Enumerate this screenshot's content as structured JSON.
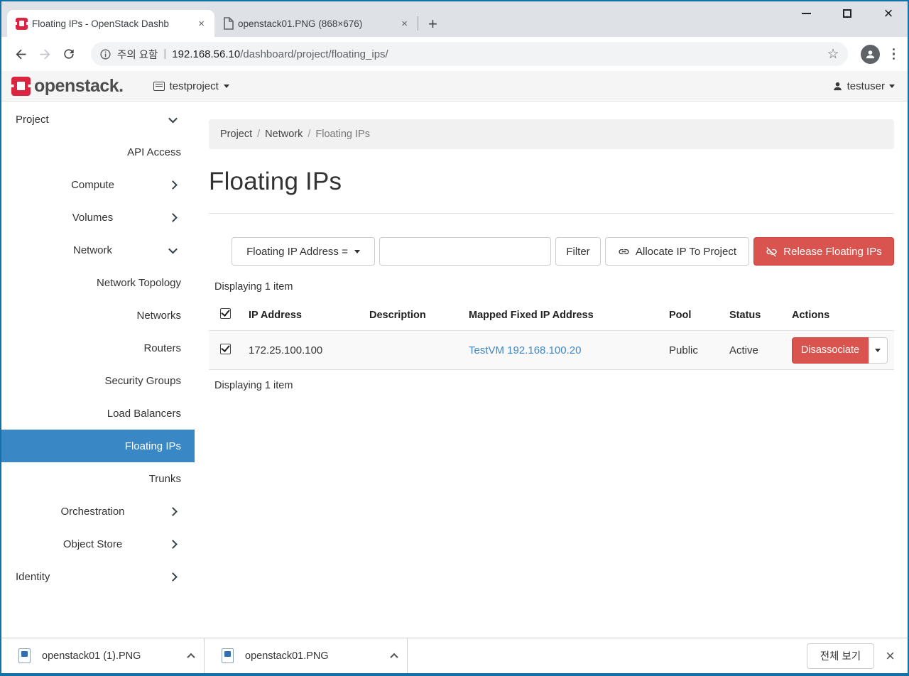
{
  "browser": {
    "tabs": [
      {
        "title": "Floating IPs - OpenStack Dashb",
        "favicon": "openstack-logo"
      },
      {
        "title": "openstack01.PNG (868×676)",
        "favicon": "document"
      }
    ],
    "new_tab_label": "+",
    "close_glyph": "×",
    "address": {
      "security_text": "주의 요함",
      "separator": "|",
      "host": "192.168.56.10",
      "path": "/dashboard/project/floating_ips/",
      "star_glyph": "☆"
    }
  },
  "header": {
    "brand": "openstack.",
    "project_switcher": "testproject",
    "user_menu": "testuser"
  },
  "sidebar": {
    "items": [
      {
        "label": "Project"
      },
      {
        "label": "API Access"
      },
      {
        "label": "Compute"
      },
      {
        "label": "Volumes"
      },
      {
        "label": "Network"
      },
      {
        "label": "Network Topology"
      },
      {
        "label": "Networks"
      },
      {
        "label": "Routers"
      },
      {
        "label": "Security Groups"
      },
      {
        "label": "Load Balancers"
      },
      {
        "label": "Floating IPs"
      },
      {
        "label": "Trunks"
      },
      {
        "label": "Orchestration"
      },
      {
        "label": "Object Store"
      },
      {
        "label": "Identity"
      }
    ]
  },
  "main": {
    "breadcrumb": {
      "items": [
        "Project",
        "Network",
        "Floating IPs"
      ],
      "separator": "/"
    },
    "title": "Floating IPs",
    "filter": {
      "dropdown_label": "Floating IP Address =",
      "input_value": "",
      "filter_button": "Filter",
      "allocate_button": "Allocate IP To Project",
      "release_button": "Release Floating IPs"
    },
    "displaying": "Displaying 1 item",
    "table": {
      "columns": [
        "IP Address",
        "Description",
        "Mapped Fixed IP Address",
        "Pool",
        "Status",
        "Actions"
      ],
      "rows": [
        {
          "ip": "172.25.100.100",
          "description": "",
          "mapped": "TestVM 192.168.100.20",
          "pool": "Public",
          "status": "Active",
          "action": "Disassociate"
        }
      ]
    }
  },
  "downloads_bar": {
    "items": [
      {
        "name": "openstack01 (1).PNG"
      },
      {
        "name": "openstack01.PNG"
      }
    ],
    "show_all": "전체 보기",
    "close_glyph": "×"
  },
  "colors": {
    "window_border": "#1271a7",
    "accent_blue": "#3987c5",
    "danger_red": "#d9534f",
    "link_blue": "#3f86c5",
    "brand_red": "#dc2340"
  }
}
